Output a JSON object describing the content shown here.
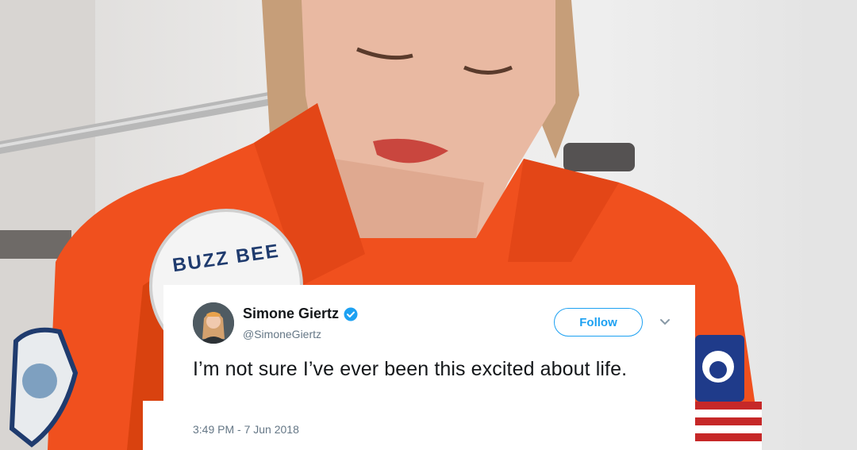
{
  "tweet": {
    "display_name": "Simone Giertz",
    "handle": "@SimoneGiertz",
    "follow_label": "Follow",
    "text": "I’m not sure I’ve ever been this excited about life.",
    "timestamp": "3:49 PM - 7 Jun 2018"
  },
  "photo": {
    "patch_text": "BUZZ BEE"
  },
  "colors": {
    "twitter_blue": "#1da1f2",
    "jumpsuit_orange": "#f0501e",
    "text_dark": "#14171a",
    "text_muted": "#657786"
  },
  "icons": {
    "verified": "verified-badge-icon",
    "more": "chevron-down-icon"
  }
}
